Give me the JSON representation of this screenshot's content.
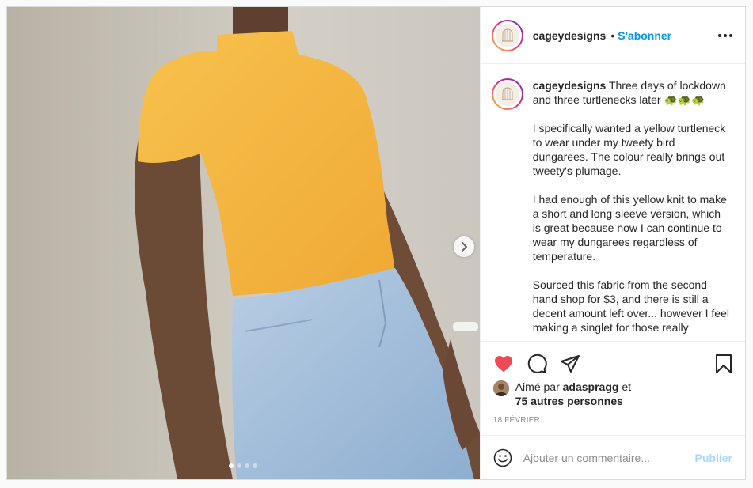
{
  "post": {
    "username": "cageydesigns",
    "separator": "•",
    "follow_label": "S'abonner",
    "caption": {
      "username": "cageydesigns",
      "paragraphs": [
        "Three days of lockdown and three turtlenecks later 🐢🐢🐢",
        "I specifically wanted a yellow turtleneck to wear under my tweety bird dungarees. The colour really brings out tweety's plumage.",
        "I had enough of this yellow knit to make a short and long sleeve version, which is great because now I can continue to wear my dungarees regardless of temperature.",
        "Sourced this fabric from the second hand shop for $3, and there is still a decent amount left over... however I feel making a singlet for those really"
      ]
    },
    "likes": {
      "prefix": "Aimé par",
      "user": "adaspragg",
      "conjunction": "et",
      "others": "75 autres personnes"
    },
    "date": "18 FÉVRIER",
    "comment_placeholder": "Ajouter un commentaire...",
    "publish_label": "Publier",
    "carousel": {
      "slide_count": 4,
      "active_slide": 1
    },
    "liked": true,
    "colors": {
      "accent": "#0095f6",
      "like": "#ed4956",
      "shirt": "#f5b641",
      "denim": "#a9c3dd",
      "wall": "#c9c4b8"
    },
    "icons": [
      "heart-icon",
      "comment-icon",
      "share-icon",
      "bookmark-icon",
      "emoji-icon",
      "more-icon",
      "chevron-right-icon"
    ]
  }
}
